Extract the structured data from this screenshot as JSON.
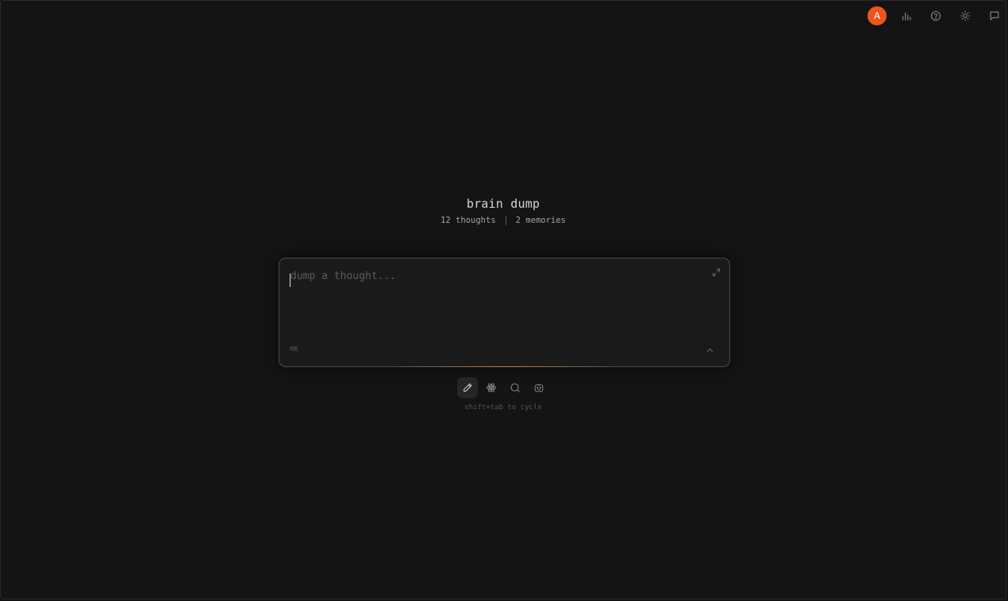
{
  "topbar": {
    "avatar_initial": "A",
    "avatar_color": "#f0541e",
    "icons": [
      "bar-chart-icon",
      "help-circle-icon",
      "sun-icon",
      "message-square-icon"
    ]
  },
  "header": {
    "title": "brain dump",
    "thoughts_count": "12 thoughts",
    "memories_count": "2 memories"
  },
  "composer": {
    "placeholder": "dump a thought...",
    "value": "",
    "shortcut_hint": "⌘K",
    "accent_color": "#d69154"
  },
  "modes": {
    "items": [
      "pencil-icon",
      "atom-icon",
      "search-icon",
      "bot-icon"
    ],
    "active": "pencil-icon",
    "hint": "shift+tab to cycle"
  }
}
